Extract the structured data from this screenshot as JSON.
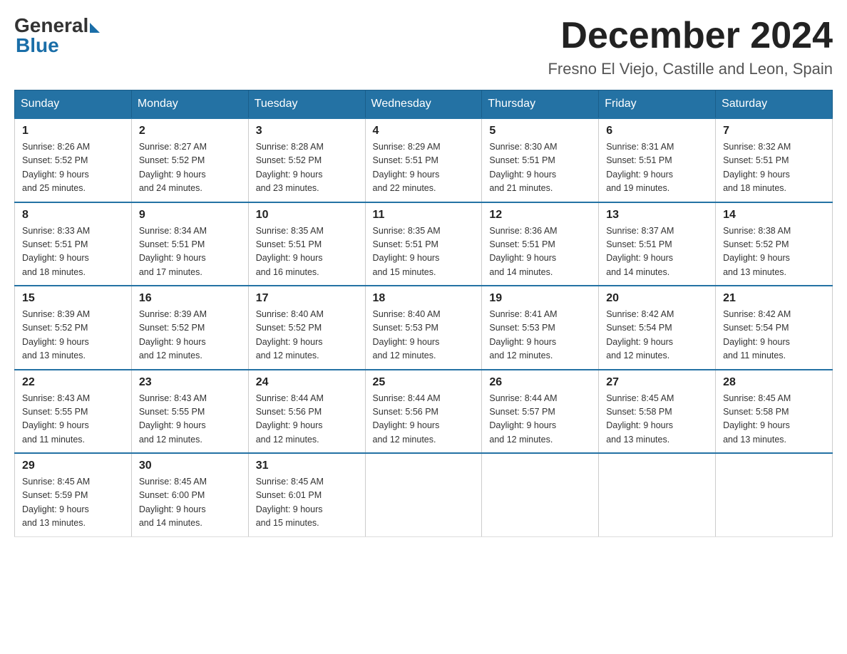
{
  "logo": {
    "general": "General",
    "blue": "Blue"
  },
  "title": "December 2024",
  "location": "Fresno El Viejo, Castille and Leon, Spain",
  "days_of_week": [
    "Sunday",
    "Monday",
    "Tuesday",
    "Wednesday",
    "Thursday",
    "Friday",
    "Saturday"
  ],
  "weeks": [
    [
      {
        "day": "1",
        "sunrise": "8:26 AM",
        "sunset": "5:52 PM",
        "daylight": "9 hours and 25 minutes."
      },
      {
        "day": "2",
        "sunrise": "8:27 AM",
        "sunset": "5:52 PM",
        "daylight": "9 hours and 24 minutes."
      },
      {
        "day": "3",
        "sunrise": "8:28 AM",
        "sunset": "5:52 PM",
        "daylight": "9 hours and 23 minutes."
      },
      {
        "day": "4",
        "sunrise": "8:29 AM",
        "sunset": "5:51 PM",
        "daylight": "9 hours and 22 minutes."
      },
      {
        "day": "5",
        "sunrise": "8:30 AM",
        "sunset": "5:51 PM",
        "daylight": "9 hours and 21 minutes."
      },
      {
        "day": "6",
        "sunrise": "8:31 AM",
        "sunset": "5:51 PM",
        "daylight": "9 hours and 19 minutes."
      },
      {
        "day": "7",
        "sunrise": "8:32 AM",
        "sunset": "5:51 PM",
        "daylight": "9 hours and 18 minutes."
      }
    ],
    [
      {
        "day": "8",
        "sunrise": "8:33 AM",
        "sunset": "5:51 PM",
        "daylight": "9 hours and 18 minutes."
      },
      {
        "day": "9",
        "sunrise": "8:34 AM",
        "sunset": "5:51 PM",
        "daylight": "9 hours and 17 minutes."
      },
      {
        "day": "10",
        "sunrise": "8:35 AM",
        "sunset": "5:51 PM",
        "daylight": "9 hours and 16 minutes."
      },
      {
        "day": "11",
        "sunrise": "8:35 AM",
        "sunset": "5:51 PM",
        "daylight": "9 hours and 15 minutes."
      },
      {
        "day": "12",
        "sunrise": "8:36 AM",
        "sunset": "5:51 PM",
        "daylight": "9 hours and 14 minutes."
      },
      {
        "day": "13",
        "sunrise": "8:37 AM",
        "sunset": "5:51 PM",
        "daylight": "9 hours and 14 minutes."
      },
      {
        "day": "14",
        "sunrise": "8:38 AM",
        "sunset": "5:52 PM",
        "daylight": "9 hours and 13 minutes."
      }
    ],
    [
      {
        "day": "15",
        "sunrise": "8:39 AM",
        "sunset": "5:52 PM",
        "daylight": "9 hours and 13 minutes."
      },
      {
        "day": "16",
        "sunrise": "8:39 AM",
        "sunset": "5:52 PM",
        "daylight": "9 hours and 12 minutes."
      },
      {
        "day": "17",
        "sunrise": "8:40 AM",
        "sunset": "5:52 PM",
        "daylight": "9 hours and 12 minutes."
      },
      {
        "day": "18",
        "sunrise": "8:40 AM",
        "sunset": "5:53 PM",
        "daylight": "9 hours and 12 minutes."
      },
      {
        "day": "19",
        "sunrise": "8:41 AM",
        "sunset": "5:53 PM",
        "daylight": "9 hours and 12 minutes."
      },
      {
        "day": "20",
        "sunrise": "8:42 AM",
        "sunset": "5:54 PM",
        "daylight": "9 hours and 12 minutes."
      },
      {
        "day": "21",
        "sunrise": "8:42 AM",
        "sunset": "5:54 PM",
        "daylight": "9 hours and 11 minutes."
      }
    ],
    [
      {
        "day": "22",
        "sunrise": "8:43 AM",
        "sunset": "5:55 PM",
        "daylight": "9 hours and 11 minutes."
      },
      {
        "day": "23",
        "sunrise": "8:43 AM",
        "sunset": "5:55 PM",
        "daylight": "9 hours and 12 minutes."
      },
      {
        "day": "24",
        "sunrise": "8:44 AM",
        "sunset": "5:56 PM",
        "daylight": "9 hours and 12 minutes."
      },
      {
        "day": "25",
        "sunrise": "8:44 AM",
        "sunset": "5:56 PM",
        "daylight": "9 hours and 12 minutes."
      },
      {
        "day": "26",
        "sunrise": "8:44 AM",
        "sunset": "5:57 PM",
        "daylight": "9 hours and 12 minutes."
      },
      {
        "day": "27",
        "sunrise": "8:45 AM",
        "sunset": "5:58 PM",
        "daylight": "9 hours and 13 minutes."
      },
      {
        "day": "28",
        "sunrise": "8:45 AM",
        "sunset": "5:58 PM",
        "daylight": "9 hours and 13 minutes."
      }
    ],
    [
      {
        "day": "29",
        "sunrise": "8:45 AM",
        "sunset": "5:59 PM",
        "daylight": "9 hours and 13 minutes."
      },
      {
        "day": "30",
        "sunrise": "8:45 AM",
        "sunset": "6:00 PM",
        "daylight": "9 hours and 14 minutes."
      },
      {
        "day": "31",
        "sunrise": "8:45 AM",
        "sunset": "6:01 PM",
        "daylight": "9 hours and 15 minutes."
      },
      null,
      null,
      null,
      null
    ]
  ],
  "labels": {
    "sunrise": "Sunrise:",
    "sunset": "Sunset:",
    "daylight": "Daylight:"
  }
}
